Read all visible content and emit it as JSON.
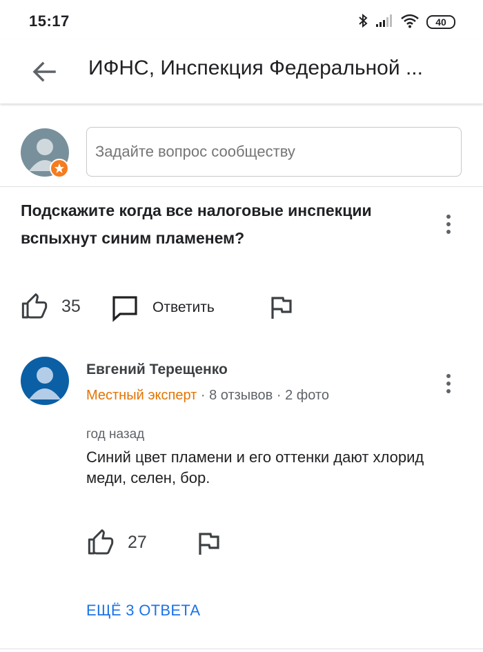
{
  "status_bar": {
    "time": "15:17",
    "battery": "40",
    "icons": [
      "bluetooth-icon",
      "signal-icon",
      "wifi-icon",
      "battery-icon"
    ]
  },
  "app_bar": {
    "title": "ИФНС, Инспекция Федеральной ..."
  },
  "ask": {
    "placeholder": "Задайте вопрос сообществу"
  },
  "question": {
    "text": "Подскажите когда все налоговые инспекции вспыхнут синим пламенем?",
    "likes": "35",
    "reply_label": "Ответить"
  },
  "answer": {
    "author": "Евгений Терещенко",
    "badge": "Местный эксперт",
    "reviews": "· 8 отзывов",
    "photos": "· 2 фото",
    "time_ago": "год назад",
    "text": "Синий цвет пламени и его оттенки дают хлорид меди, селен, бор.",
    "likes": "27"
  },
  "more_answers": "ЕЩЁ 3 ОТВЕТА",
  "colors": {
    "accent_blue": "#1a73e8",
    "expert_orange": "#e37400",
    "user_avatar_bg": "#78909c",
    "author_avatar_bg": "#0b5fa5",
    "badge_orange": "#f57c1f"
  }
}
